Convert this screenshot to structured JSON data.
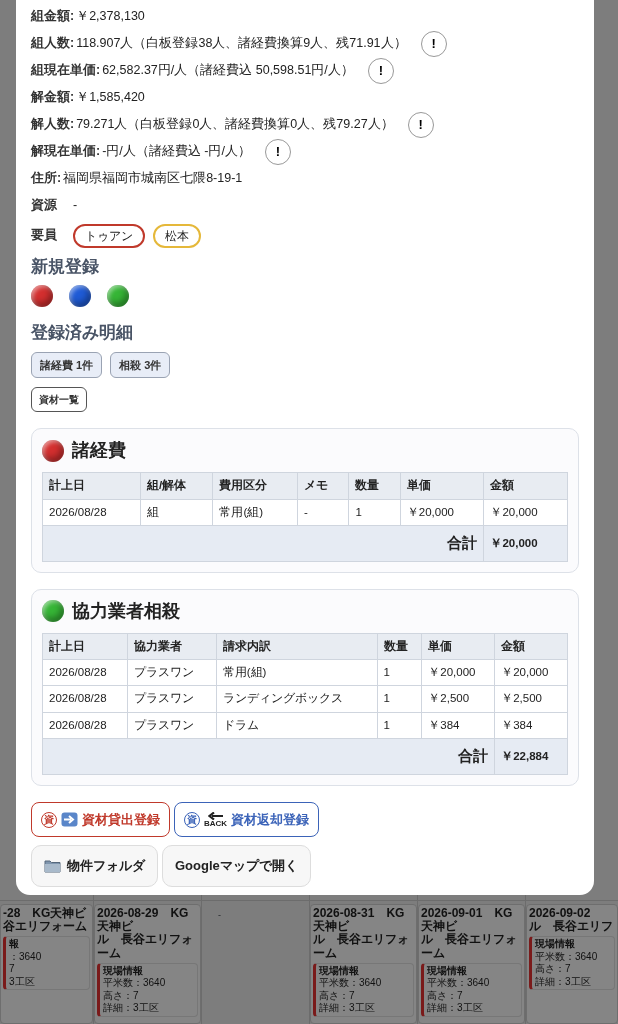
{
  "summary_rows": [
    {
      "label": "組金額:",
      "value": "￥2,378,130"
    },
    {
      "label": "組人数:",
      "value": "118.907人（白板登録38人、諸経費換算9人、残71.91人）",
      "note_button": "!"
    },
    {
      "label": "組現在単価:",
      "value": "62,582.37円/人（諸経費込 50,598.51円/人）",
      "note_button": "!"
    },
    {
      "label": "解金額:",
      "value": "￥1,585,420"
    },
    {
      "label": "解人数:",
      "value": "79.271人（白板登録0人、諸経費換算0人、残79.27人）",
      "note_button": "!"
    },
    {
      "label": "解現在単価:",
      "value": "-円/人（諸経費込 -円/人）",
      "note_button": "!"
    },
    {
      "label": "住所:",
      "value": "福岡県福岡市城南区七隈8-19-1"
    }
  ],
  "resource": {
    "label": "資源",
    "value": "-"
  },
  "staff": {
    "label": "要員",
    "members": [
      {
        "name": "トゥアン",
        "color": "#c0392b"
      },
      {
        "name": "松本",
        "color": "#e5b83a"
      }
    ]
  },
  "new_registration": {
    "title": "新規登録",
    "balls": [
      {
        "color": "#d32f2f"
      },
      {
        "color": "#1f5bd6"
      },
      {
        "color": "#36b536"
      }
    ]
  },
  "registered": {
    "title": "登録済み明細",
    "tags": [
      "諸経費 1件",
      "相殺 3件"
    ],
    "list_button": "資材一覧"
  },
  "sections": [
    {
      "title": "諸経費",
      "color": "#d32f2f",
      "columns": [
        "計上日",
        "組/解体",
        "費用区分",
        "メモ",
        "数量",
        "単価",
        "金額"
      ],
      "rows": [
        [
          "2026/08/28",
          "組",
          "常用(組)",
          "-",
          "1",
          "￥20,000",
          "￥20,000"
        ]
      ],
      "total_label": "合計",
      "total_value": "￥20,000"
    },
    {
      "title": "協力業者相殺",
      "color": "#36b536",
      "columns": [
        "計上日",
        "協力業者",
        "請求内訳",
        "数量",
        "単価",
        "金額"
      ],
      "rows": [
        [
          "2026/08/28",
          "プラスワン",
          "常用(組)",
          "1",
          "￥20,000",
          "￥20,000"
        ],
        [
          "2026/08/28",
          "プラスワン",
          "ランディングボックス",
          "1",
          "￥2,500",
          "￥2,500"
        ],
        [
          "2026/08/28",
          "プラスワン",
          "ドラム",
          "1",
          "￥384",
          "￥384"
        ]
      ],
      "total_label": "合計",
      "total_value": "￥22,884"
    }
  ],
  "material_buttons": [
    {
      "kind": "lend",
      "badge": "資",
      "label": "資材貸出登録"
    },
    {
      "kind": "return",
      "badge": "資",
      "back": "BACK",
      "label": "資材返却登録"
    }
  ],
  "link_buttons": [
    {
      "kind": "folder",
      "label": "物件フォルダ"
    },
    {
      "kind": "map",
      "label": "Googleマップで開く"
    }
  ],
  "calendar_cards": [
    {
      "title_lines": [
        "-28　KG天神ビ",
        "谷エリフォーム"
      ],
      "info_title": "報",
      "lines": [
        "：3640",
        "7",
        "3工区"
      ]
    },
    {
      "title_lines": [
        "2026-08-29　KG天神ビ",
        "ル　長谷エリフォーム"
      ],
      "info_title": "現場情報",
      "lines": [
        "平米数：3640",
        "高さ：7",
        "詳細：3工区"
      ]
    },
    {
      "empty": "-"
    },
    {
      "title_lines": [
        "2026-08-31　KG天神ビ",
        "ル　長谷エリフォーム"
      ],
      "info_title": "現場情報",
      "lines": [
        "平米数：3640",
        "高さ：7",
        "詳細：3工区"
      ]
    },
    {
      "title_lines": [
        "2026-09-01　KG天神ビ",
        "ル　長谷エリフォーム"
      ],
      "info_title": "現場情報",
      "lines": [
        "平米数：3640",
        "高さ：7",
        "詳細：3工区"
      ]
    },
    {
      "title_lines": [
        "2026-09-02",
        "ル　長谷エリフ"
      ],
      "info_title": "現場情報",
      "lines": [
        "平米数：3640",
        "高さ：7",
        "詳細：3工区"
      ]
    }
  ]
}
